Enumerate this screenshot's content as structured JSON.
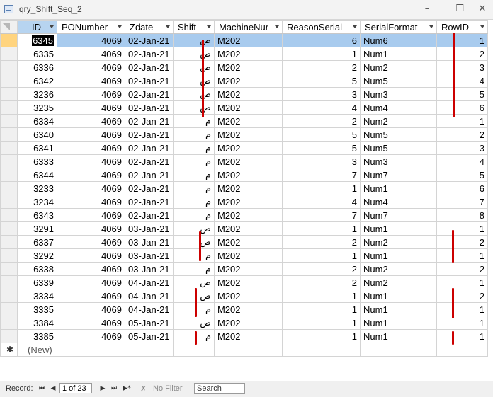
{
  "window": {
    "title": "qry_Shift_Seq_2"
  },
  "columns": [
    "ID",
    "PONumber",
    "Zdate",
    "Shift",
    "MachineNur",
    "ReasonSerial",
    "SerialFormat",
    "RowID"
  ],
  "rows": [
    [
      "6345",
      "4069",
      "02-Jan-21",
      "ص",
      "M202",
      "6",
      "Num6",
      "1"
    ],
    [
      "6335",
      "4069",
      "02-Jan-21",
      "ص",
      "M202",
      "1",
      "Num1",
      "2"
    ],
    [
      "6336",
      "4069",
      "02-Jan-21",
      "ص",
      "M202",
      "2",
      "Num2",
      "3"
    ],
    [
      "6342",
      "4069",
      "02-Jan-21",
      "ص",
      "M202",
      "5",
      "Num5",
      "4"
    ],
    [
      "3236",
      "4069",
      "02-Jan-21",
      "ص",
      "M202",
      "3",
      "Num3",
      "5"
    ],
    [
      "3235",
      "4069",
      "02-Jan-21",
      "ص",
      "M202",
      "4",
      "Num4",
      "6"
    ],
    [
      "6334",
      "4069",
      "02-Jan-21",
      "م",
      "M202",
      "2",
      "Num2",
      "1"
    ],
    [
      "6340",
      "4069",
      "02-Jan-21",
      "م",
      "M202",
      "5",
      "Num5",
      "2"
    ],
    [
      "6341",
      "4069",
      "02-Jan-21",
      "م",
      "M202",
      "5",
      "Num5",
      "3"
    ],
    [
      "6333",
      "4069",
      "02-Jan-21",
      "م",
      "M202",
      "3",
      "Num3",
      "4"
    ],
    [
      "6344",
      "4069",
      "02-Jan-21",
      "م",
      "M202",
      "7",
      "Num7",
      "5"
    ],
    [
      "3233",
      "4069",
      "02-Jan-21",
      "م",
      "M202",
      "1",
      "Num1",
      "6"
    ],
    [
      "3234",
      "4069",
      "02-Jan-21",
      "م",
      "M202",
      "4",
      "Num4",
      "7"
    ],
    [
      "6343",
      "4069",
      "02-Jan-21",
      "م",
      "M202",
      "7",
      "Num7",
      "8"
    ],
    [
      "3291",
      "4069",
      "03-Jan-21",
      "ص",
      "M202",
      "1",
      "Num1",
      "1"
    ],
    [
      "6337",
      "4069",
      "03-Jan-21",
      "ص",
      "M202",
      "2",
      "Num2",
      "2"
    ],
    [
      "3292",
      "4069",
      "03-Jan-21",
      "م",
      "M202",
      "1",
      "Num1",
      "1"
    ],
    [
      "6338",
      "4069",
      "03-Jan-21",
      "م",
      "M202",
      "2",
      "Num2",
      "2"
    ],
    [
      "6339",
      "4069",
      "04-Jan-21",
      "ص",
      "M202",
      "2",
      "Num2",
      "1"
    ],
    [
      "3334",
      "4069",
      "04-Jan-21",
      "ص",
      "M202",
      "1",
      "Num1",
      "2"
    ],
    [
      "3335",
      "4069",
      "04-Jan-21",
      "م",
      "M202",
      "1",
      "Num1",
      "1"
    ],
    [
      "3384",
      "4069",
      "05-Jan-21",
      "ص",
      "M202",
      "1",
      "Num1",
      "1"
    ],
    [
      "3385",
      "4069",
      "05-Jan-21",
      "م",
      "M202",
      "1",
      "Num1",
      "1"
    ]
  ],
  "new_row_label": "(New)",
  "navbar": {
    "record_label": "Record:",
    "position": "1 of 23",
    "filter_label": "No Filter",
    "search_label": "Search"
  },
  "icons": {
    "table": "table-icon",
    "minimize": "minimize-icon",
    "restore": "restore-icon",
    "close": "close-icon",
    "first": "first-record-icon",
    "prev": "previous-record-icon",
    "next": "next-record-icon",
    "last": "last-record-icon",
    "new": "new-record-icon",
    "filter": "no-filter-icon"
  },
  "colors": {
    "selected_row": "#a8cbee",
    "current_record": "#ffd47f",
    "annotation": "#cc0000"
  }
}
